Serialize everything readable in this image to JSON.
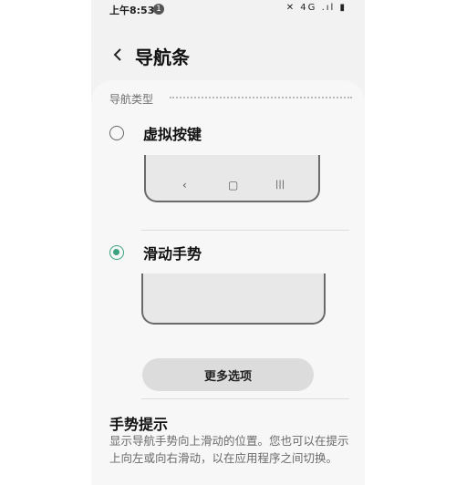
{
  "status_bar": {
    "time": "上午8:53",
    "notification_count": "1",
    "icons": "✕ 4G .ıl ▮"
  },
  "header": {
    "back_icon": "chevron-left-icon",
    "title": "导航条"
  },
  "nav_type": {
    "section_label": "导航类型",
    "options": [
      {
        "label": "虚拟按键",
        "selected": false
      },
      {
        "label": "滑动手势",
        "selected": true
      }
    ],
    "keys_preview": {
      "back": "‹",
      "home": "▢",
      "recents": "|||"
    }
  },
  "more_options": {
    "label": "更多选项"
  },
  "gesture_hint": {
    "title": "手势提示",
    "description": "显示导航手势向上滑动的位置。您也可以在提示上向左或向右滑动，以在应用程序之间切换。"
  },
  "colors": {
    "accent": "#3aa37e",
    "background": "#f2f2f2"
  }
}
